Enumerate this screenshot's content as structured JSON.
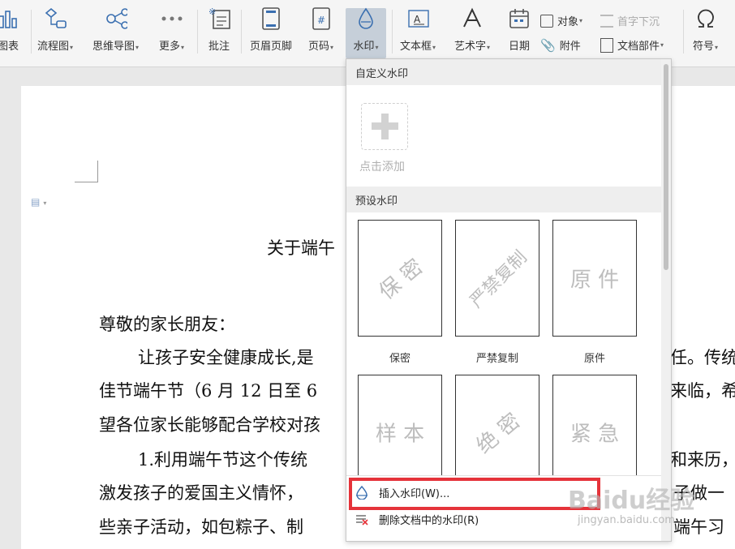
{
  "ribbon": {
    "chart_label": "图表",
    "flowchart_label": "流程图",
    "mindmap_label": "思维导图",
    "more_label": "更多",
    "comment_label": "批注",
    "header_footer_label": "页眉页脚",
    "page_number_label": "页码",
    "watermark_label": "水印",
    "textbox_label": "文本框",
    "wordart_label": "艺术字",
    "date_label": "日期",
    "object_label": "对象",
    "attachment_label": "附件",
    "dropcap_label": "首字下沉",
    "doc_parts_label": "文档部件",
    "symbol_label": "符号"
  },
  "document": {
    "title": "关于端午",
    "lines": [
      "尊敬的家长朋友：",
      "让孩子安全健康成长,是",
      "佳节端午节（6 月 12 日至 6",
      "望各位家长能够配合学校对孩",
      "1.利用端午节这个传统",
      "激发孩子的爱国主义情怀，",
      "些亲子活动，如包粽子、制"
    ],
    "right_fragments": [
      "任。传统",
      "来临，希",
      "和来历，",
      "子做一",
      "端午习"
    ]
  },
  "watermark_menu": {
    "custom_header": "自定义水印",
    "add_label": "点击添加",
    "preset_header": "预设水印",
    "presets": [
      {
        "text": "保 密",
        "caption": "保密"
      },
      {
        "text": "严禁复制",
        "caption": "严禁复制"
      },
      {
        "text": "原 件",
        "caption": "原件"
      },
      {
        "text": "样 本",
        "caption": ""
      },
      {
        "text": "绝 密",
        "caption": ""
      },
      {
        "text": "紧 急",
        "caption": ""
      }
    ],
    "insert_label": "插入水印(W)...",
    "delete_label": "删除文档中的水印(R)"
  },
  "overlay": {
    "baidu_logo": "Baidu经验",
    "baidu_url": "jingyan.baidu.com"
  },
  "colors": {
    "highlight": "#e5333a",
    "ribbon_bg": "#f5f5f5",
    "active_btn": "#c6cfd9"
  }
}
